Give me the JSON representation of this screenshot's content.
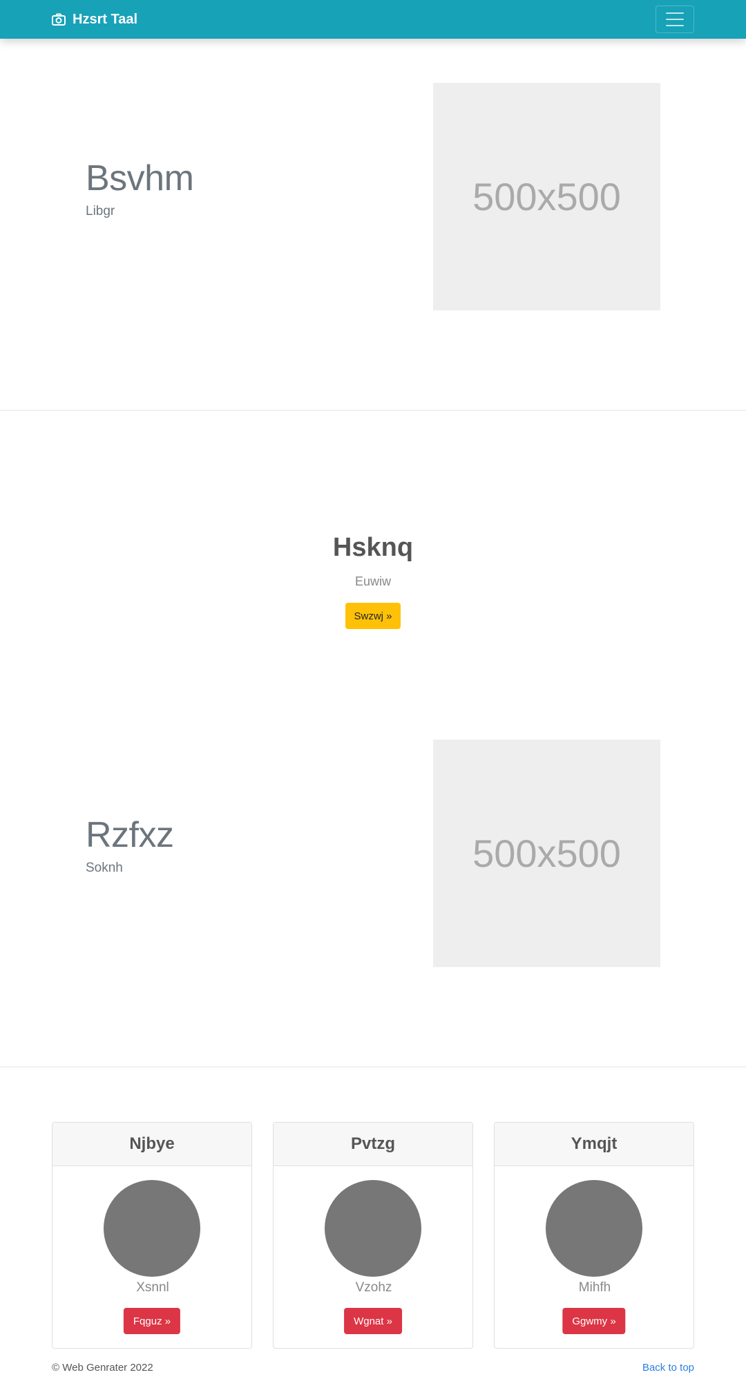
{
  "navbar": {
    "brand": "Hzsrt Taal",
    "brand_icon": "camera-icon",
    "toggle_icon": "hamburger-menu-icon",
    "bg_color": "#17a2b8"
  },
  "hero1": {
    "title": "Bsvhm",
    "subtitle": "Libgr",
    "image_label": "500x500"
  },
  "center": {
    "title": "Hsknq",
    "subtitle": "Euwiw",
    "button_label": "Swzwj »",
    "button_color": "#ffc107"
  },
  "hero2": {
    "title": "Rzfxz",
    "subtitle": "Soknh",
    "image_label": "500x500"
  },
  "cards": [
    {
      "header": "Njbye",
      "text": "Xsnnl",
      "button_label": "Fqguz »"
    },
    {
      "header": "Pvtzg",
      "text": "Vzohz",
      "button_label": "Wgnat »"
    },
    {
      "header": "Ymqjt",
      "text": "Mihfh",
      "button_label": "Ggwmy »"
    }
  ],
  "card_button_color": "#dc3545",
  "footer": {
    "copyright": "© Web Genrater 2022",
    "back_to_top": "Back to top"
  }
}
